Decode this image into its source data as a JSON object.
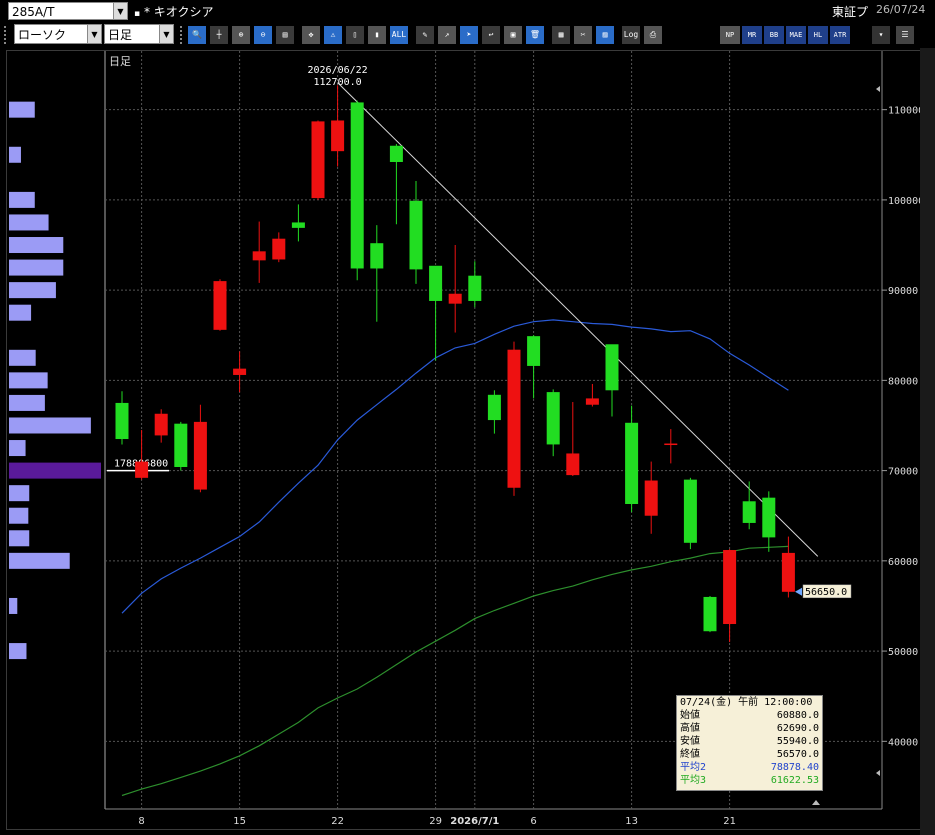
{
  "toolbar": {
    "symbol_code": "285A/T",
    "symbol_name": "* キオクシア",
    "exchange": "東証プ",
    "date": "26/07/24",
    "chart_type": "ローソク",
    "period": "日足",
    "buttons_right": [
      "NP",
      "MR",
      "BB",
      "MAE",
      "HL",
      "ATR"
    ]
  },
  "chart": {
    "period_label": "日足",
    "high_date": "2026/06/22",
    "high_value": "112700.0",
    "volume_profile_label": "178886800",
    "current_price_label": "56650.0"
  },
  "infobox": {
    "header": "07/24(金) 午前 12:00:00",
    "rows": [
      {
        "label": "始値",
        "value": "60880.0",
        "color": "#000000"
      },
      {
        "label": "高値",
        "value": "62690.0",
        "color": "#000000"
      },
      {
        "label": "安値",
        "value": "55940.0",
        "color": "#000000"
      },
      {
        "label": "終値",
        "value": "56570.0",
        "color": "#000000"
      },
      {
        "label": "平均2",
        "value": "78878.40",
        "color": "#2244cc"
      },
      {
        "label": "平均3",
        "value": "61622.53",
        "color": "#22aa22"
      }
    ]
  },
  "colors": {
    "up": "#22dd22",
    "down": "#ee1111",
    "ma2": "#2a5ad8",
    "ma3": "#2d8f2d",
    "volume_profile": "#9b9bf5",
    "volume_profile_peak": "#5a1a9a",
    "trendline": "#d8d8d8"
  },
  "chart_data": {
    "type": "candlestick",
    "y_ticks": [
      "110000.0",
      "100000.0",
      "90000.0",
      "80000.0",
      "70000.0",
      "60000.0",
      "50000.0",
      "40000.0"
    ],
    "y_tick_values": [
      110000,
      100000,
      90000,
      80000,
      70000,
      60000,
      50000,
      40000
    ],
    "ylim": [
      32500,
      116500
    ],
    "x_tick_labels": [
      "8",
      "15",
      "22",
      "29",
      "2026/7/1",
      "6",
      "13",
      "21"
    ],
    "x_tick_index": [
      1,
      6,
      11,
      16,
      18,
      21,
      26,
      31
    ],
    "candles": [
      {
        "o": 73500,
        "h": 78800,
        "l": 72900,
        "c": 77500
      },
      {
        "o": 71000,
        "h": 74500,
        "l": 69000,
        "c": 69200
      },
      {
        "o": 76300,
        "h": 76800,
        "l": 73100,
        "c": 73900
      },
      {
        "o": 70400,
        "h": 75400,
        "l": 70000,
        "c": 75200
      },
      {
        "o": 75400,
        "h": 77300,
        "l": 67600,
        "c": 67900
      },
      {
        "o": 91000,
        "h": 91200,
        "l": 85500,
        "c": 85600
      },
      {
        "o": 81300,
        "h": 83200,
        "l": 78700,
        "c": 80600
      },
      {
        "o": 94300,
        "h": 97600,
        "l": 90800,
        "c": 93300
      },
      {
        "o": 95700,
        "h": 96400,
        "l": 93100,
        "c": 93400
      },
      {
        "o": 96900,
        "h": 99500,
        "l": 95400,
        "c": 97500
      },
      {
        "o": 108700,
        "h": 108800,
        "l": 100000,
        "c": 100200
      },
      {
        "o": 108800,
        "h": 112700,
        "l": 103700,
        "c": 105400
      },
      {
        "o": 92400,
        "h": 111000,
        "l": 91100,
        "c": 110800
      },
      {
        "o": 92400,
        "h": 97200,
        "l": 86500,
        "c": 95200
      },
      {
        "o": 104200,
        "h": 106200,
        "l": 97300,
        "c": 106000
      },
      {
        "o": 92300,
        "h": 102100,
        "l": 90700,
        "c": 99900
      },
      {
        "o": 88800,
        "h": 92400,
        "l": 82200,
        "c": 92700
      },
      {
        "o": 89600,
        "h": 95000,
        "l": 85300,
        "c": 88500
      },
      {
        "o": 88800,
        "h": 93200,
        "l": 88100,
        "c": 91600
      },
      {
        "o": 75600,
        "h": 78900,
        "l": 74100,
        "c": 78400
      },
      {
        "o": 83400,
        "h": 84300,
        "l": 67200,
        "c": 68100
      },
      {
        "o": 81600,
        "h": 85000,
        "l": 78000,
        "c": 84900
      },
      {
        "o": 72900,
        "h": 79000,
        "l": 71600,
        "c": 78700
      },
      {
        "o": 71900,
        "h": 77600,
        "l": 69400,
        "c": 69500
      },
      {
        "o": 78000,
        "h": 79600,
        "l": 77100,
        "c": 77300
      },
      {
        "o": 78900,
        "h": 83900,
        "l": 76000,
        "c": 84000
      },
      {
        "o": 66300,
        "h": 77200,
        "l": 65400,
        "c": 75300
      },
      {
        "o": 68900,
        "h": 71000,
        "l": 63000,
        "c": 65000
      },
      {
        "o": 73000,
        "h": 74600,
        "l": 70800,
        "c": 72900
      },
      {
        "o": 62000,
        "h": 69200,
        "l": 61300,
        "c": 69000
      },
      {
        "o": 52200,
        "h": 56100,
        "l": 52100,
        "c": 56000
      },
      {
        "o": 61200,
        "h": 61300,
        "l": 51000,
        "c": 53000
      },
      {
        "o": 64200,
        "h": 68800,
        "l": 63500,
        "c": 66600
      },
      {
        "o": 62600,
        "h": 67700,
        "l": 61000,
        "c": 67000
      },
      {
        "o": 60880,
        "h": 62690,
        "l": 55940,
        "c": 56570
      }
    ],
    "ma2": [
      54200,
      56400,
      58000,
      59200,
      60300,
      61500,
      62700,
      64300,
      66500,
      68600,
      70600,
      73400,
      75600,
      77300,
      79000,
      80800,
      82500,
      83600,
      84100,
      85100,
      86000,
      86500,
      86700,
      86500,
      86300,
      86200,
      85900,
      85700,
      85400,
      85500,
      84600,
      83000,
      81700,
      80300,
      78900
    ],
    "ma3": [
      34000,
      34700,
      35300,
      36000,
      36700,
      37500,
      38400,
      39500,
      40800,
      42100,
      43700,
      44800,
      45800,
      47100,
      48500,
      49900,
      51100,
      52300,
      53600,
      54500,
      55300,
      56100,
      56700,
      57200,
      57900,
      58500,
      59000,
      59400,
      59900,
      60300,
      60800,
      61000,
      61400,
      61500,
      61600
    ],
    "trendline": {
      "from": {
        "i": 11,
        "value": 113000
      },
      "to": {
        "i": 35.5,
        "value": 60500
      }
    },
    "volume_profile": [
      {
        "price": 110000,
        "volume": 0.28
      },
      {
        "price": 105000,
        "volume": 0.13
      },
      {
        "price": 100000,
        "volume": 0.28
      },
      {
        "price": 97500,
        "volume": 0.43
      },
      {
        "price": 95000,
        "volume": 0.59
      },
      {
        "price": 92500,
        "volume": 0.59
      },
      {
        "price": 90000,
        "volume": 0.51
      },
      {
        "price": 87500,
        "volume": 0.24
      },
      {
        "price": 82500,
        "volume": 0.29
      },
      {
        "price": 80000,
        "volume": 0.42
      },
      {
        "price": 77500,
        "volume": 0.39
      },
      {
        "price": 75000,
        "volume": 0.89
      },
      {
        "price": 72500,
        "volume": 0.18
      },
      {
        "price": 70000,
        "volume": 1.0,
        "peak": true
      },
      {
        "price": 67500,
        "volume": 0.22
      },
      {
        "price": 65000,
        "volume": 0.21
      },
      {
        "price": 62500,
        "volume": 0.22
      },
      {
        "price": 60000,
        "volume": 0.66
      },
      {
        "price": 55000,
        "volume": 0.09
      },
      {
        "price": 50000,
        "volume": 0.19
      }
    ]
  }
}
